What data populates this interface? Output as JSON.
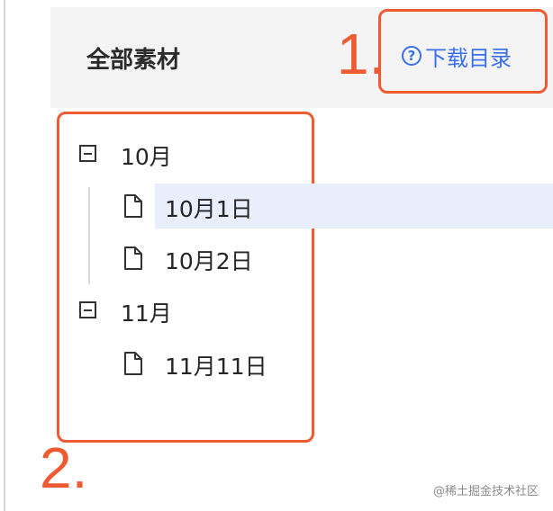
{
  "panel": {
    "title": "全部素材",
    "download_label": "下载目录",
    "help_glyph": "?"
  },
  "annotations": {
    "one": "1.",
    "two": "2."
  },
  "tree": {
    "months": [
      {
        "label": "10月",
        "days": [
          "10月1日",
          "10月2日"
        ]
      },
      {
        "label": "11月",
        "days": [
          "11月11日"
        ]
      }
    ],
    "selected": "10月1日"
  },
  "watermark": "@稀土掘金技术社区",
  "colors": {
    "accent": "#3a6fe8",
    "annotation": "#ee5a32",
    "selected_bg": "#e8eefc"
  },
  "icons": {
    "expanded_toggle": "minus-square-icon",
    "leaf": "file-icon",
    "help": "question-circle-icon"
  }
}
